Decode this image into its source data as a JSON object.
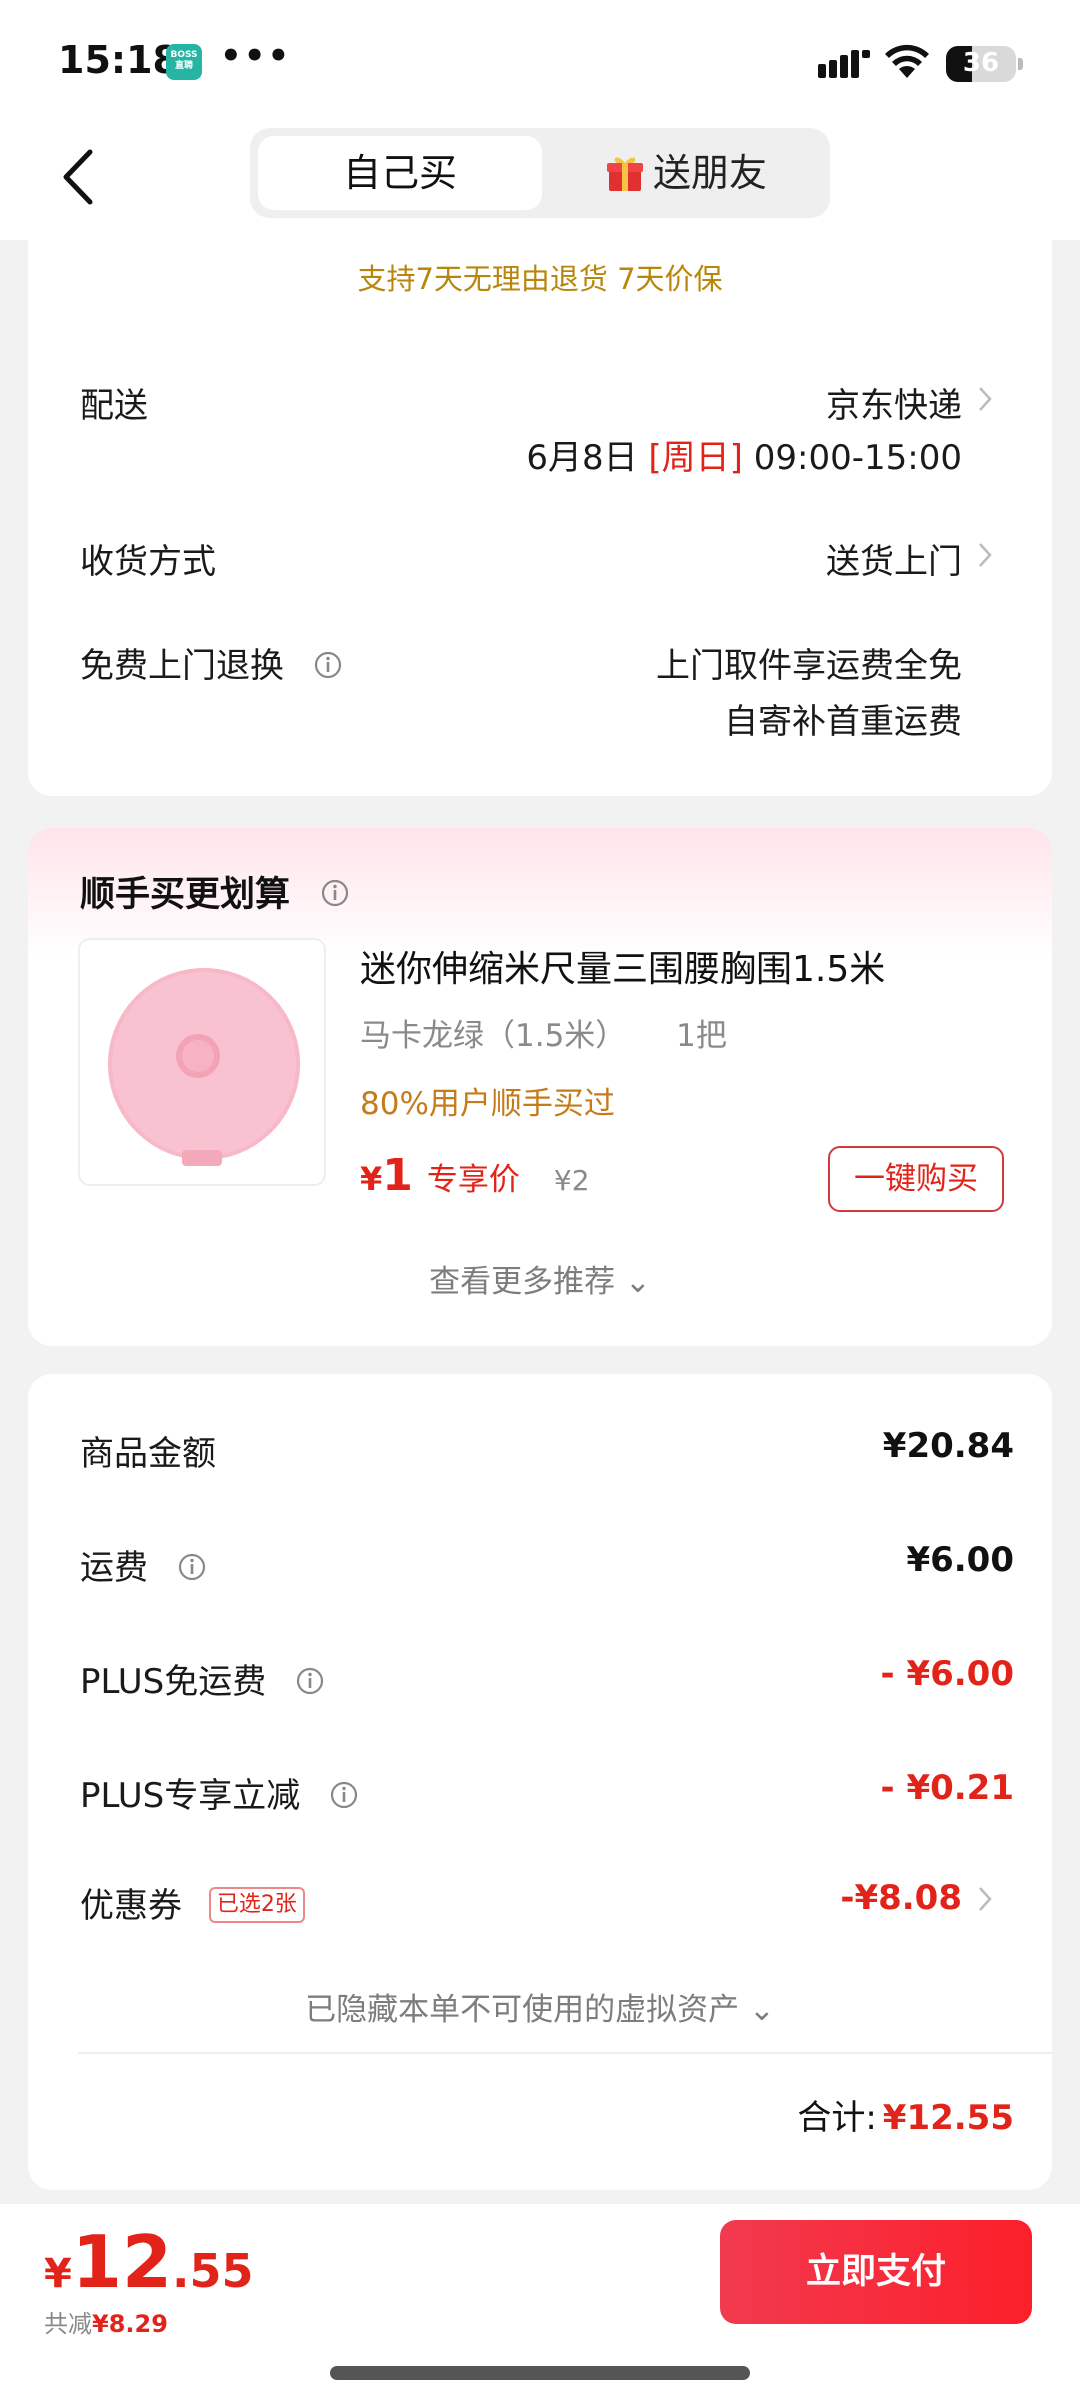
{
  "status_bar": {
    "time": "15:18",
    "app_badge": "BOSS\n直聘",
    "more": "•••",
    "battery": "36"
  },
  "nav": {
    "tab_self": "自己买",
    "tab_gift": "送朋友"
  },
  "delivery": {
    "return_policy": "支持7天无理由退货 7天价保",
    "shipping_label": "配送",
    "shipping_carrier": "京东快递",
    "shipping_date": "6月8日",
    "shipping_day": "[周日]",
    "shipping_time": "09:00-15:00",
    "receive_label": "收货方式",
    "receive_value": "送货上门",
    "return_label": "免费上门退换",
    "return_value_1": "上门取件享运费全免",
    "return_value_2": "自寄补首重运费"
  },
  "addon": {
    "title": "顺手买更划算",
    "product_title": "迷你伸缩米尺量三围腰胸围1.5米",
    "variant": "马卡龙绿（1.5米）",
    "quantity": "1把",
    "social_proof": "80%用户顺手买过",
    "price_yen": "¥",
    "price": "1",
    "price_tag": "专享价",
    "original_price": "¥2",
    "buy_button": "一键购买",
    "more": "查看更多推荐 ⌄"
  },
  "summary": {
    "goods_label": "商品金额",
    "goods_value": "¥20.84",
    "freight_label": "运费",
    "freight_value": "¥6.00",
    "plus_freight_label": "PLUS免运费",
    "plus_freight_value": "- ¥6.00",
    "plus_discount_label": "PLUS专享立减",
    "plus_discount_value": "- ¥0.21",
    "coupon_label": "优惠券",
    "coupon_badge": "已选2张",
    "coupon_value": "-¥8.08",
    "hidden_assets": "已隐藏本单不可使用的虚拟资产 ⌄",
    "total_label": "合计:",
    "total_value": "¥12.55"
  },
  "bottom": {
    "yen": "¥",
    "price_int": "12",
    "price_dec": ".55",
    "saved_label": "共减",
    "saved_value": "¥8.29",
    "pay_button": "立即支付"
  },
  "colors": {
    "accent_red": "#e2231a",
    "policy_gold": "#b8860b",
    "social_orange": "#c57b1a",
    "product_pink": "#f7b8c8"
  }
}
